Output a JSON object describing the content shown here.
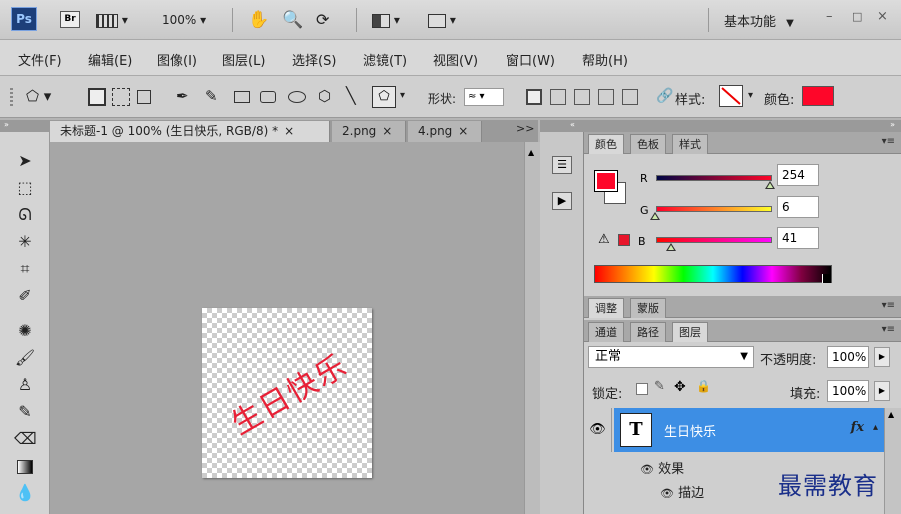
{
  "titlebar": {
    "app_logo": "Ps",
    "bridge_logo": "Br",
    "zoom": "100%",
    "workspace": "基本功能",
    "workspace_arrow": "▼",
    "minimize": "–",
    "maximize": "□",
    "close": "×"
  },
  "menubar": {
    "items": [
      "文件(F)",
      "编辑(E)",
      "图像(I)",
      "图层(L)",
      "选择(S)",
      "滤镜(T)",
      "视图(V)",
      "窗口(W)",
      "帮助(H)"
    ]
  },
  "options": {
    "shape_label": "形状:",
    "style_label": "样式:",
    "color_label": "颜色:",
    "color_value": "#fe0629"
  },
  "tabs": [
    {
      "label": "未标题-1 @ 100% (生日快乐, RGB/8) *",
      "close": "×",
      "active": true
    },
    {
      "label": "2.png",
      "close": "×",
      "active": false
    },
    {
      "label": "4.png",
      "close": "×",
      "active": false
    }
  ],
  "tabs_overflow": ">>",
  "canvas": {
    "text": "生日快乐",
    "text_color": "#e82036"
  },
  "color_panel": {
    "tabs": [
      "颜色",
      "色板",
      "样式"
    ],
    "channels": [
      {
        "label": "R",
        "value": "254"
      },
      {
        "label": "G",
        "value": "6"
      },
      {
        "label": "B",
        "value": "41"
      }
    ],
    "foreground": "#fe0629",
    "background": "#ffffff"
  },
  "adjust_panel": {
    "tabs": [
      "调整",
      "蒙版"
    ]
  },
  "layers_panel": {
    "tabs": [
      "通道",
      "路径",
      "图层"
    ],
    "blend_mode": "正常",
    "opacity_label": "不透明度:",
    "opacity_value": "100%",
    "lock_label": "锁定:",
    "fill_label": "填充:",
    "fill_value": "100%",
    "layer": {
      "thumb": "T",
      "name": "生日快乐",
      "fx": "fx"
    },
    "effects_label": "效果",
    "stroke_label": "描边"
  },
  "watermark": "最需教育"
}
